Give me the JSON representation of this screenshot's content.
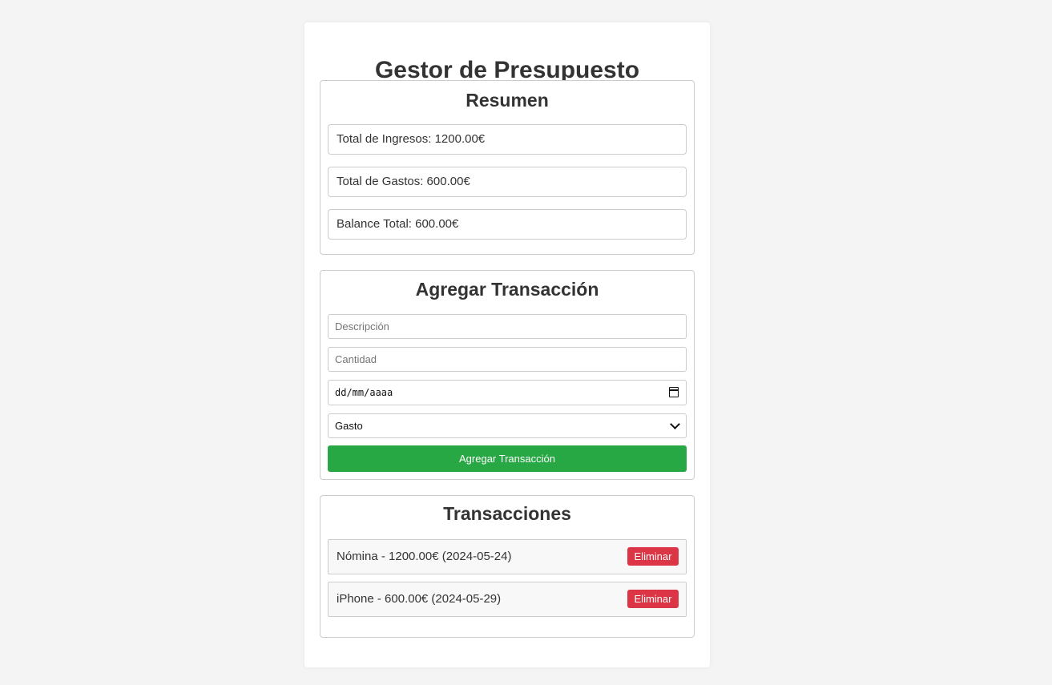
{
  "app_title": "Gestor de Presupuesto",
  "summary": {
    "heading": "Resumen",
    "income_text": "Total de Ingresos: 1200.00€",
    "expenses_text": "Total de Gastos: 600.00€",
    "balance_text": "Balance Total: 600.00€"
  },
  "add_form": {
    "heading": "Agregar Transacción",
    "description_placeholder": "Descripción",
    "amount_placeholder": "Cantidad",
    "date_value": "dd/mm/aaaa",
    "type_selected": "Gasto",
    "submit_label": "Agregar Transacción"
  },
  "transactions": {
    "heading": "Transacciones",
    "items": [
      {
        "text": "Nómina - 1200.00€ (2024-05-24)",
        "delete_label": "Eliminar"
      },
      {
        "text": "iPhone - 600.00€ (2024-05-29)",
        "delete_label": "Eliminar"
      }
    ]
  },
  "colors": {
    "accent_green": "#28a745",
    "danger_red": "#dc3545",
    "background": "#f4f4f4"
  }
}
